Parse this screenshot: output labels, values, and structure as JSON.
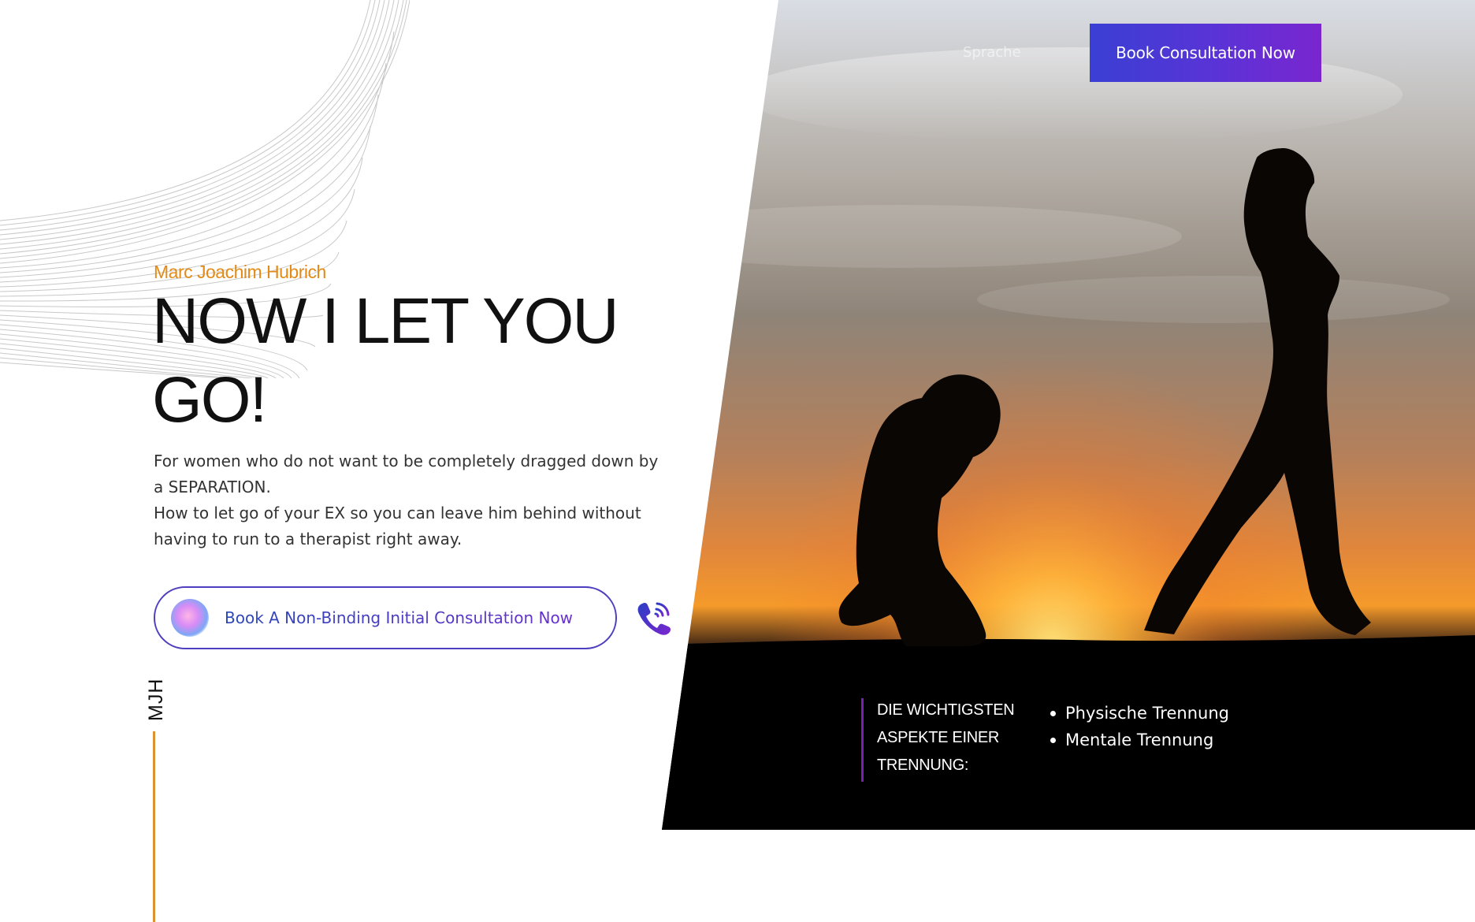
{
  "header": {
    "nav_link_label": "Sprache",
    "cta_label": "Book Consultation Now"
  },
  "hero": {
    "author": "Marc Joachim Hubrich",
    "headline_line1": "NOW I LET YOU",
    "headline_line2": "GO!",
    "sub_line1": "For women who do not want to be completely dragged down by",
    "sub_line2": "a SEPARATION.",
    "sub_line3": "How to let go of your EX so you can leave him behind without",
    "sub_line4": "having to run to a therapist right away.",
    "cta_label": "Book A Non-Binding Initial Consultation Now",
    "side_label": "MJH"
  },
  "aspects": {
    "title_line1": "DIE WICHTIGSTEN",
    "title_line2": "ASPEKTE EINER",
    "title_line3": "TRENNUNG:",
    "items": [
      "Physische Trennung",
      "Mentale Trennung"
    ]
  },
  "colors": {
    "accent_orange": "#e38a16",
    "accent_purple": "#5a33d6",
    "accent_blue": "#3a3fd4",
    "divider_purple": "#7a1fb0"
  },
  "icons": {
    "phone": "phone-call-icon",
    "orb": "gradient-orb-icon"
  }
}
